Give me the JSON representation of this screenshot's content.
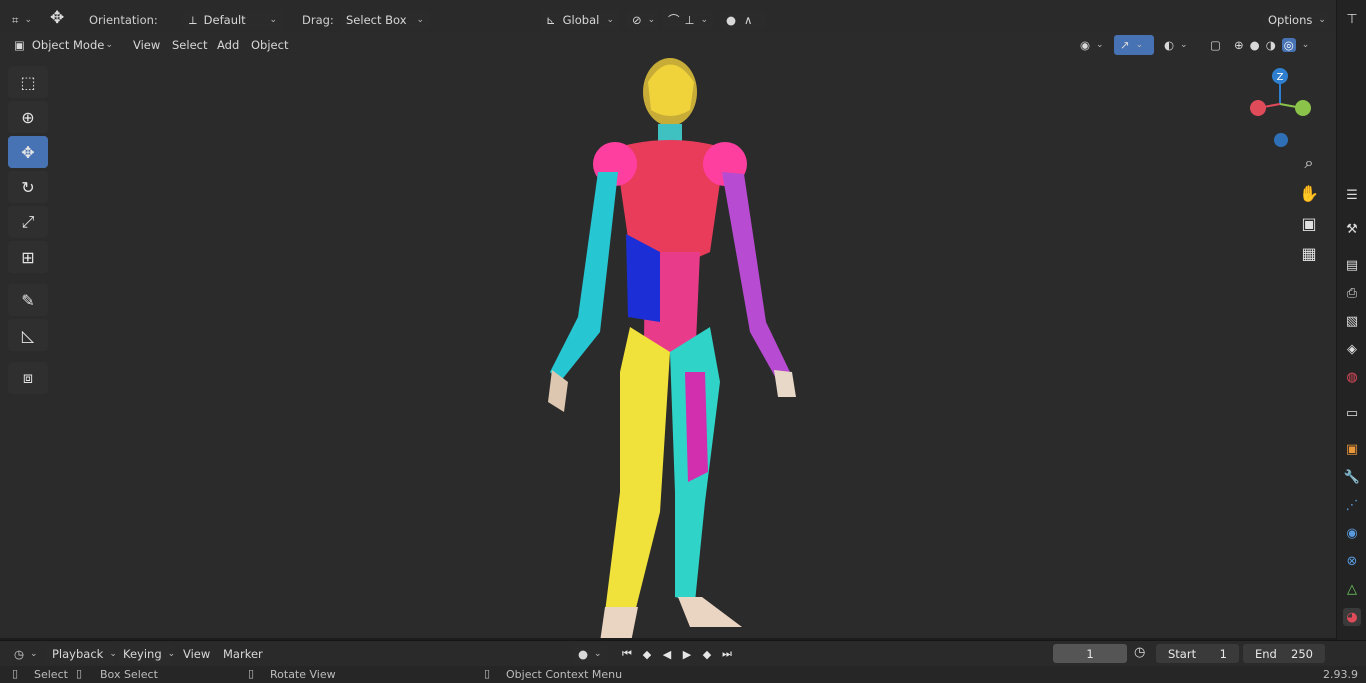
{
  "tool_header": {
    "orientation_label": "Orientation:",
    "orientation_value": "Default",
    "drag_label": "Drag:",
    "drag_value": "Select Box",
    "transform_space": "Global",
    "options_label": "Options"
  },
  "viewport_header": {
    "mode": "Object Mode",
    "menus": [
      "View",
      "Select",
      "Add",
      "Object"
    ]
  },
  "gizmo": {
    "z_label": "Z"
  },
  "toolbar": {
    "tools": [
      "select-box",
      "cursor",
      "move",
      "rotate",
      "scale",
      "transform",
      "annotate",
      "measure",
      "add-cube"
    ],
    "active_tool": "move"
  },
  "timeline": {
    "menus": [
      "Playback",
      "Keying",
      "View",
      "Marker"
    ],
    "current_frame": "1",
    "start_label": "Start",
    "start_value": "1",
    "end_label": "End",
    "end_value": "250"
  },
  "statusbar": {
    "select": "Select",
    "box_select": "Box Select",
    "rotate_view": "Rotate View",
    "context_menu": "Object Context Menu",
    "version": "2.93.9"
  },
  "colors": {
    "accent": "#4772b3",
    "axis_x": "#e04b5a",
    "axis_y": "#8bc34a",
    "axis_z": "#2f7fd0"
  }
}
